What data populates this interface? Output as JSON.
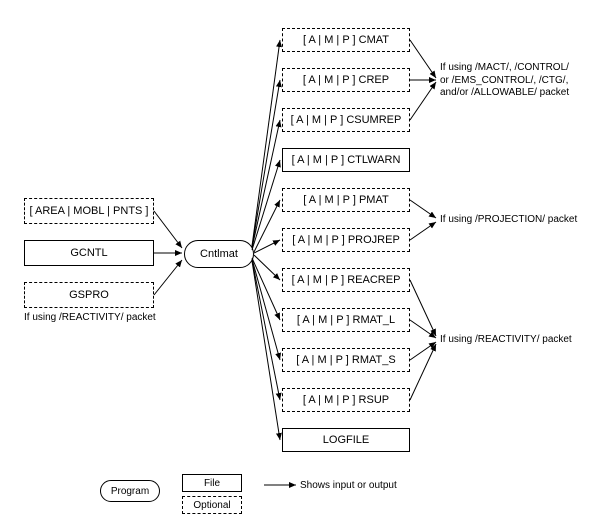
{
  "inputs": {
    "area": "[ AREA | MOBL | PNTS ]",
    "gcntl": "GCNTL",
    "gspro": "GSPRO"
  },
  "input_note": "If using /REACTIVITY/ packet",
  "program": "Cntlmat",
  "outputs": {
    "cmat": "[ A | M | P ] CMAT",
    "crep": "[ A | M | P ] CREP",
    "csumrep": "[ A | M | P ] CSUMREP",
    "ctlwarn": "[ A | M | P ] CTLWARN",
    "pmat": "[ A | M | P ] PMAT",
    "projrep": "[ A | M | P ] PROJREP",
    "reacrep": "[ A | M | P ] REACREP",
    "rmat_l": "[ A | M | P ] RMAT_L",
    "rmat_s": "[ A | M | P ] RMAT_S",
    "rsup": "[ A | M | P ] RSUP",
    "logfile": "LOGFILE"
  },
  "notes": {
    "mact": "If using /MACT/, /CONTROL/\nor /EMS_CONTROL/, /CTG/,\nand/or /ALLOWABLE/ packet",
    "projection": "If using /PROJECTION/ packet",
    "reactivity": "If using /REACTIVITY/ packet"
  },
  "legend": {
    "program": "Program",
    "file": "File",
    "optional": "Optional",
    "arrow": "Shows input or output"
  }
}
